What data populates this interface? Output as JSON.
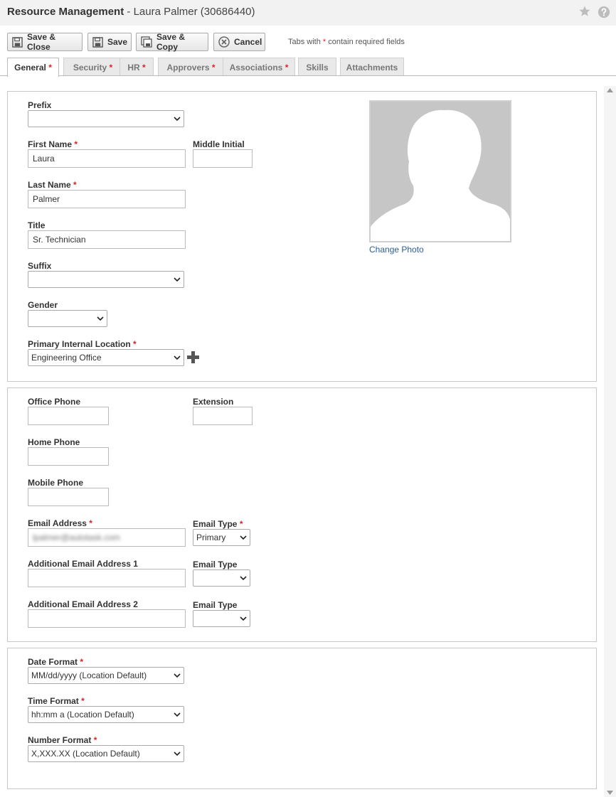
{
  "window": {
    "app_title": "Resource Management",
    "separator": " - ",
    "record_title": "Laura Palmer (30686440)"
  },
  "toolbar": {
    "save_close": "Save & Close",
    "save": "Save",
    "save_copy": "Save & Copy",
    "cancel": "Cancel",
    "required_note_prefix": "Tabs with ",
    "required_note_suffix": " contain required fields"
  },
  "required_marker": "*",
  "tabs": [
    {
      "label": "General",
      "required": true,
      "active": true
    },
    {
      "label": "Security",
      "required": true
    },
    {
      "label": "HR",
      "required": true
    },
    {
      "label": "Approvers",
      "required": true
    },
    {
      "label": "Associations",
      "required": true
    },
    {
      "label": "Skills",
      "required": false
    },
    {
      "label": "Attachments",
      "required": false
    }
  ],
  "general": {
    "prefix": {
      "label": "Prefix",
      "value": ""
    },
    "first_name": {
      "label": "First Name",
      "value": "Laura"
    },
    "middle_initial": {
      "label": "Middle Initial",
      "value": ""
    },
    "last_name": {
      "label": "Last Name",
      "value": "Palmer"
    },
    "title": {
      "label": "Title",
      "value": "Sr. Technician"
    },
    "suffix": {
      "label": "Suffix",
      "value": ""
    },
    "gender": {
      "label": "Gender",
      "value": ""
    },
    "primary_location": {
      "label": "Primary Internal Location",
      "value": "Engineering Office"
    },
    "change_photo": "Change Photo"
  },
  "contact": {
    "office_phone": {
      "label": "Office Phone",
      "value": ""
    },
    "extension": {
      "label": "Extension",
      "value": ""
    },
    "home_phone": {
      "label": "Home Phone",
      "value": ""
    },
    "mobile_phone": {
      "label": "Mobile Phone",
      "value": ""
    },
    "email": {
      "label": "Email Address",
      "value": "lpalmer@autotask.com"
    },
    "email_type": {
      "label": "Email Type",
      "value": "Primary"
    },
    "additional_email_1": {
      "label": "Additional Email Address 1",
      "value": ""
    },
    "email_type_1": {
      "label": "Email Type",
      "value": ""
    },
    "additional_email_2": {
      "label": "Additional Email Address 2",
      "value": ""
    },
    "email_type_2": {
      "label": "Email Type",
      "value": ""
    }
  },
  "formats": {
    "date": {
      "label": "Date Format",
      "value": "MM/dd/yyyy (Location Default)"
    },
    "time": {
      "label": "Time Format",
      "value": "hh:mm a (Location Default)"
    },
    "number": {
      "label": "Number Format",
      "value": "X,XXX.XX (Location Default)"
    }
  },
  "colors": {
    "required": "#dd2222",
    "link": "#2a5d9f"
  }
}
